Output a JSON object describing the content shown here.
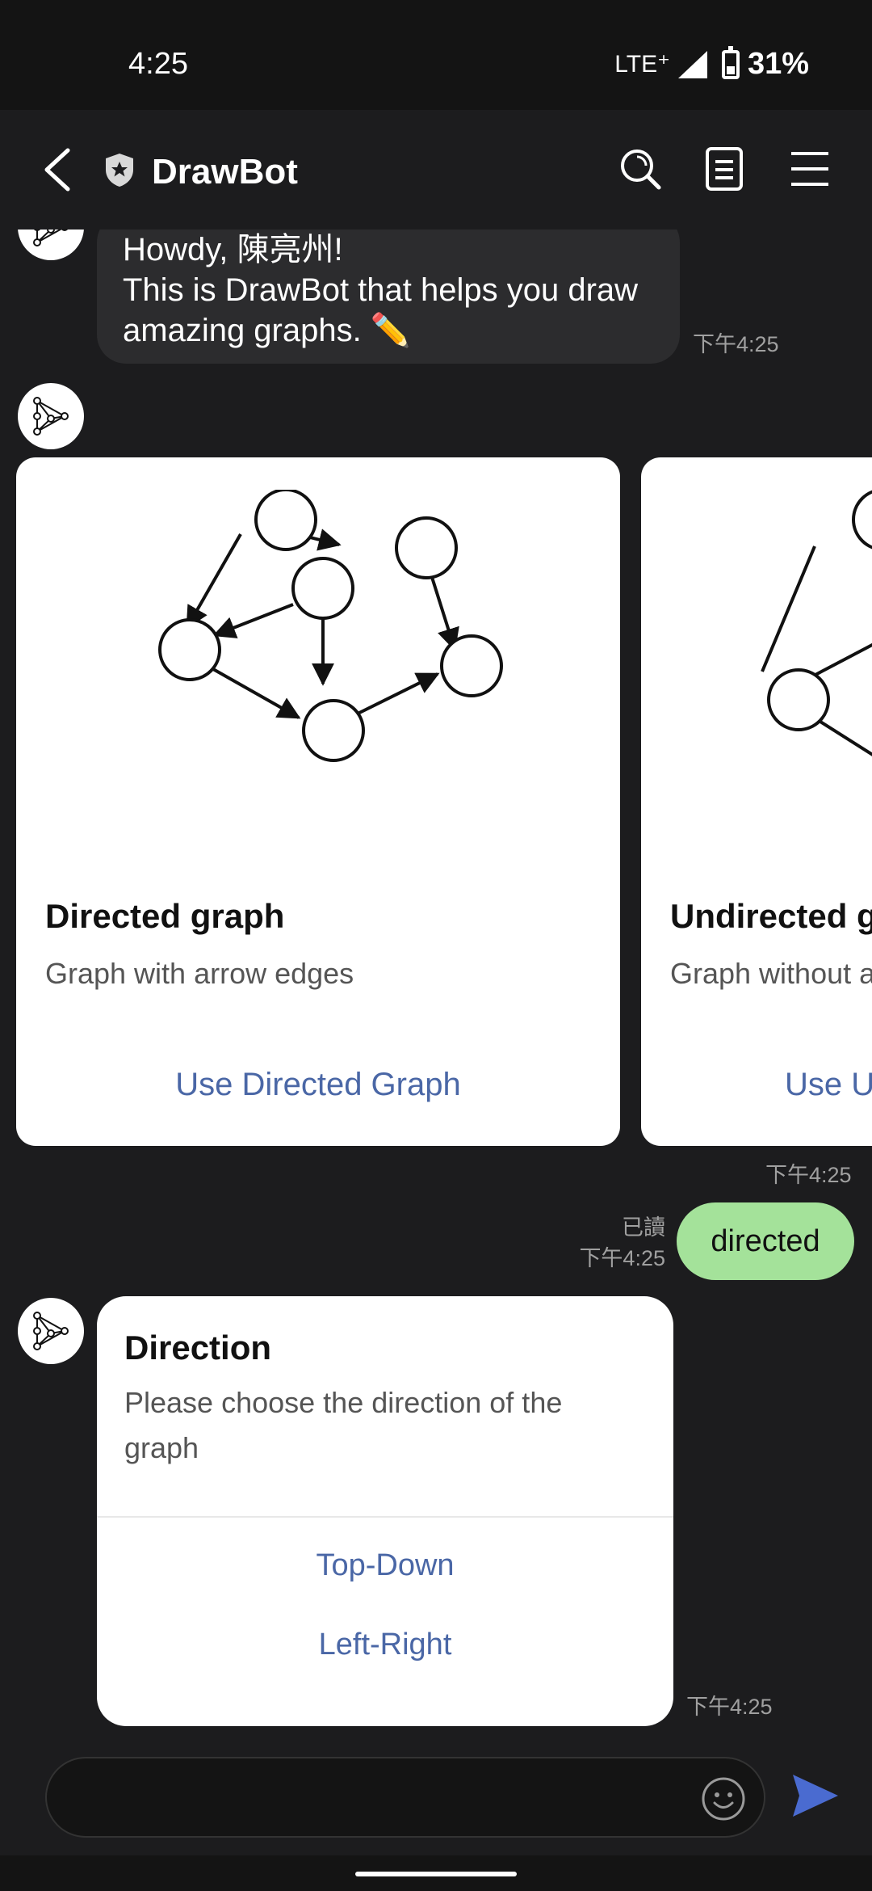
{
  "status": {
    "time": "4:25",
    "network": "LTE⁺",
    "battery": "31%"
  },
  "header": {
    "title": "DrawBot"
  },
  "messages": {
    "greeting_line1": "Howdy, 陳亮州!",
    "greeting_line2": "This is DrawBot that helps you draw",
    "greeting_line3": "amazing graphs. ✏️",
    "greeting_time": "下午4:25",
    "carousel_time": "下午4:25",
    "user_text": "directed",
    "user_read": "已讀",
    "user_time": "下午4:25",
    "direction_time": "下午4:25"
  },
  "carousel": [
    {
      "title": "Directed graph",
      "subtitle": "Graph with arrow edges",
      "action": "Use Directed Graph"
    },
    {
      "title": "Undirected g",
      "subtitle": "Graph without a",
      "action": "Use U"
    }
  ],
  "direction_card": {
    "title": "Direction",
    "subtitle": "Please choose the direction of the graph",
    "options": [
      "Top-Down",
      "Left-Right"
    ]
  },
  "colors": {
    "background": "#1c1c1e",
    "bubble_user": "#a4e29a",
    "link": "#4a67a6",
    "send": "#4a6bd0"
  },
  "icons": [
    "back-icon",
    "shield-icon",
    "search-icon",
    "notes-icon",
    "menu-icon",
    "emoji-icon",
    "send-icon",
    "bot-avatar-icon"
  ]
}
